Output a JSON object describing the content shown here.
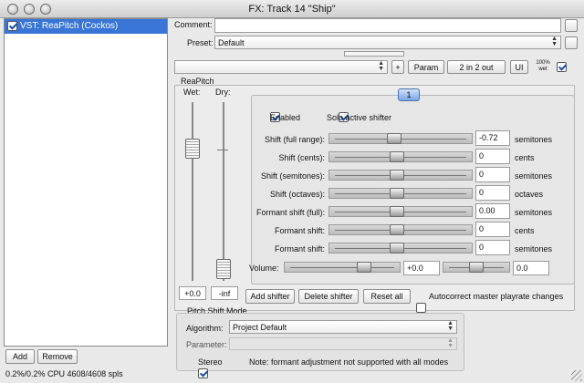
{
  "window": {
    "title": "FX: Track 14 \"Ship\""
  },
  "plugin_list": {
    "items": [
      {
        "label": "VST: ReaPitch (Cockos)",
        "checked": true
      }
    ]
  },
  "left_buttons": {
    "add": "Add",
    "remove": "Remove"
  },
  "status": "0.2%/0.2% CPU 4608/4608 spls",
  "header": {
    "comment_label": "Comment:",
    "comment_value": "",
    "preset_label": "Preset:",
    "preset_value": "Default",
    "param_label": "Param",
    "io_label": "2 in 2 out",
    "ui_label": "UI",
    "wet_label_top": "100%",
    "wet_label_bottom": "wet",
    "add_symbol": "+"
  },
  "reapitch": {
    "title": "ReaPitch",
    "wet_label": "Wet:",
    "dry_label": "Dry:",
    "wet_value": "+0.0",
    "dry_value": "-inf",
    "tab_number": "1",
    "enabled_label": "Enabled",
    "solo_label": "Solo active shifter",
    "params": [
      {
        "label": "Shift (full range):",
        "value": "-0.72",
        "unit": "semitones",
        "pos": 0.45
      },
      {
        "label": "Shift (cents):",
        "value": "0",
        "unit": "cents",
        "pos": 0.47
      },
      {
        "label": "Shift (semitones):",
        "value": "0",
        "unit": "semitones",
        "pos": 0.47
      },
      {
        "label": "Shift (octaves):",
        "value": "0",
        "unit": "octaves",
        "pos": 0.47
      },
      {
        "label": "Formant shift (full):",
        "value": "0.00",
        "unit": "semitones",
        "pos": 0.47
      },
      {
        "label": "Formant shift:",
        "value": "0",
        "unit": "cents",
        "pos": 0.47
      },
      {
        "label": "Formant shift:",
        "value": "0",
        "unit": "semitones",
        "pos": 0.47
      }
    ],
    "volume_label": "Volume:",
    "volume_value": "+0.0",
    "pan_value": "0.0",
    "add_shifter": "Add shifter",
    "delete_shifter": "Delete shifter",
    "reset_all": "Reset all",
    "autocorrect_label": "Autocorrect master playrate changes"
  },
  "pitch_mode": {
    "title": "Pitch Shift Mode",
    "algorithm_label": "Algorithm:",
    "algorithm_value": "Project Default",
    "parameter_label": "Parameter:",
    "parameter_value": "",
    "stereo_label": "Stereo",
    "note": "Note: formant adjustment not supported with all modes"
  }
}
